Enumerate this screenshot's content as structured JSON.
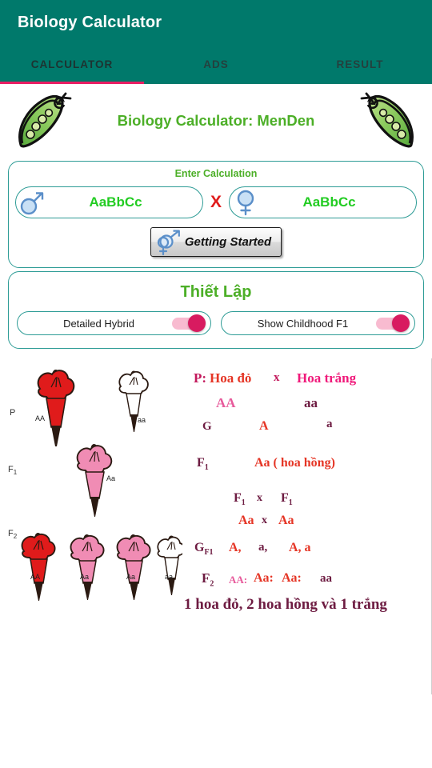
{
  "app": {
    "title": "Biology Calculator",
    "accent_teal": "#00796B",
    "accent_pink": "#E91E63",
    "accent_green": "#4CAF27"
  },
  "tabs": [
    {
      "label": "CALCULATOR",
      "active": true
    },
    {
      "label": "ADS",
      "active": false
    },
    {
      "label": "RESULT",
      "active": false
    }
  ],
  "header": {
    "page_title": "Biology Calculator: MenDen",
    "left_icon": "pea-pod-icon",
    "right_icon": "pea-pod-icon"
  },
  "calculator": {
    "card_title": "Enter Calculation",
    "male": {
      "icon": "male-symbol-icon",
      "value": "AaBbCc",
      "placeholder": "AaBbCc"
    },
    "cross_symbol": "X",
    "female": {
      "icon": "female-symbol-icon",
      "value": "AaBbCc",
      "placeholder": "AaBbCc"
    },
    "button": {
      "label": "Getting Started",
      "icon": "male-female-combined-icon"
    }
  },
  "settings": {
    "card_title": "Thiết Lập",
    "toggles": [
      {
        "label": "Detailed Hybrid",
        "state": "on"
      },
      {
        "label": "Show Childhood F1",
        "state": "on"
      }
    ]
  },
  "result": {
    "diagram_icon": "flower-inheritance-diagram",
    "flower_rows": [
      {
        "generation": "P",
        "generation_sub": "",
        "flowers": [
          {
            "color": "red",
            "genotype": "AA"
          },
          {
            "color": "white",
            "genotype": "aa"
          }
        ]
      },
      {
        "generation": "F",
        "generation_sub": "1",
        "flowers": [
          {
            "color": "pink",
            "genotype": "Aa"
          }
        ]
      },
      {
        "generation": "F",
        "generation_sub": "2",
        "flowers": [
          {
            "color": "red",
            "genotype": "AA"
          },
          {
            "color": "pink",
            "genotype": "Aa"
          },
          {
            "color": "pink",
            "genotype": "Aa"
          },
          {
            "color": "white",
            "genotype": "aa"
          }
        ]
      }
    ],
    "text_lines": {
      "p_label": "P:",
      "p_parent1": "Hoa đỏ",
      "p_cross": "x",
      "p_parent2": "Hoa trắng",
      "p_geno1": "AA",
      "p_geno2": "aa",
      "g_label": "G",
      "g_gamete1": "A",
      "g_gamete2": "a",
      "f1_label": "F",
      "f1_sub": "1",
      "f1_geno": "Aa ( hoa hồng)",
      "f1_cross_left": "F",
      "f1_cross_left_sub": "1",
      "f1_cross_symbol": "x",
      "f1_cross_right": "F",
      "f1_cross_right_sub": "1",
      "f1_geno_left": "Aa",
      "f1_geno_cross": "x",
      "f1_geno_right": "Aa",
      "gf1_label": "G",
      "gf1_sub": "F1",
      "gf1_gametes_a": "A,",
      "gf1_gametes_b": "a,",
      "gf1_gametes_c": "A, a",
      "f2_label": "F",
      "f2_sub": "2",
      "f2_ratio_1": "AA:",
      "f2_ratio_2": "Aa:",
      "f2_ratio_3": "Aa:",
      "f2_ratio_4": "aa",
      "conclusion": "1 hoa đỏ, 2 hoa hồng và 1 trắng"
    }
  }
}
